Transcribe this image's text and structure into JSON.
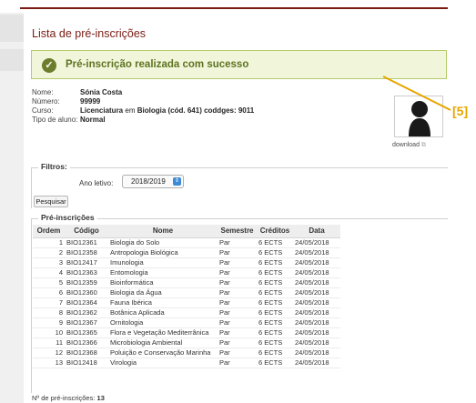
{
  "page": {
    "title": "Lista de pré-inscrições"
  },
  "alert": {
    "message": "Pré-inscrição realizada com sucesso",
    "icon": "check-circle-icon",
    "color": "#5d7321"
  },
  "student": {
    "labels": {
      "name": "Nome:",
      "number": "Número:",
      "course": "Curso:",
      "type": "Tipo de aluno:"
    },
    "name": "Sónia Costa",
    "number": "99999",
    "course_degree": "Licenciatura",
    "course_connector": "em",
    "course_rest": "Biologia (cód. 641) coddges: 9011",
    "type": "Normal"
  },
  "photo": {
    "download_label": "download",
    "icon": "person-silhouette-icon"
  },
  "callout": {
    "label": "[5]",
    "color": "#e6a600"
  },
  "filters": {
    "legend": "Filtros:",
    "year_label": "Ano letivo:",
    "year_value": "2018/2019",
    "search_label": "Pesquisar"
  },
  "list": {
    "legend": "Pré-inscrições",
    "columns": [
      "Ordem",
      "Código",
      "Nome",
      "Semestre",
      "Créditos",
      "Data"
    ],
    "rows": [
      [
        "1",
        "BIO12361",
        "Biologia do Solo",
        "Par",
        "6 ECTS",
        "24/05/2018"
      ],
      [
        "2",
        "BIO12358",
        "Antropologia Biológica",
        "Par",
        "6 ECTS",
        "24/05/2018"
      ],
      [
        "3",
        "BIO12417",
        "Imunologia",
        "Par",
        "6 ECTS",
        "24/05/2018"
      ],
      [
        "4",
        "BIO12363",
        "Entomologia",
        "Par",
        "6 ECTS",
        "24/05/2018"
      ],
      [
        "5",
        "BIO12359",
        "Bioinformática",
        "Par",
        "6 ECTS",
        "24/05/2018"
      ],
      [
        "6",
        "BIO12360",
        "Biologia da Água",
        "Par",
        "6 ECTS",
        "24/05/2018"
      ],
      [
        "7",
        "BIO12364",
        "Fauna Ibérica",
        "Par",
        "6 ECTS",
        "24/05/2018"
      ],
      [
        "8",
        "BIO12362",
        "Botânica Aplicada",
        "Par",
        "6 ECTS",
        "24/05/2018"
      ],
      [
        "9",
        "BIO12367",
        "Ornitologia",
        "Par",
        "6 ECTS",
        "24/05/2018"
      ],
      [
        "10",
        "BIO12365",
        "Flora e Vegetação Mediterrânica",
        "Par",
        "6 ECTS",
        "24/05/2018"
      ],
      [
        "11",
        "BIO12366",
        "Microbiologia Ambiental",
        "Par",
        "6 ECTS",
        "24/05/2018"
      ],
      [
        "12",
        "BIO12368",
        "Poluição e Conservação Marinha",
        "Par",
        "6 ECTS",
        "24/05/2018"
      ],
      [
        "13",
        "BIO12418",
        "Virologia",
        "Par",
        "6 ECTS",
        "24/05/2018"
      ]
    ],
    "count_label": "Nº de pré-inscrições:",
    "count_value": "13"
  }
}
